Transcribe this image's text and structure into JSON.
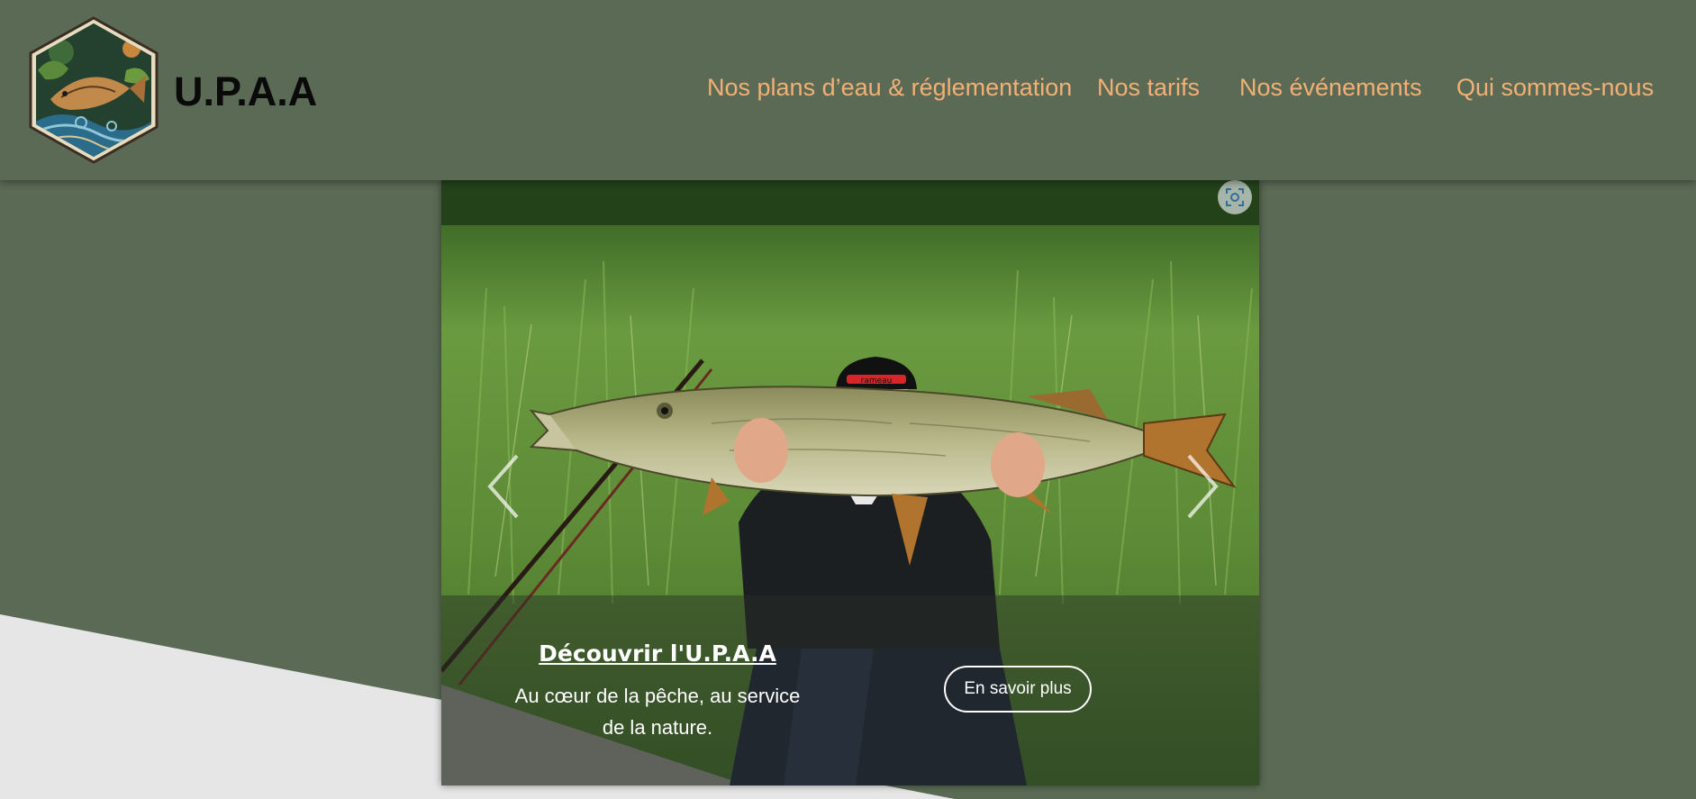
{
  "header": {
    "brand": "U.P.A.A",
    "nav": [
      {
        "label": "Nos plans d’eau & réglementation"
      },
      {
        "label": "Nos tarifs"
      },
      {
        "label": "Nos événements"
      },
      {
        "label": "Qui sommes-nous"
      }
    ]
  },
  "carousel": {
    "caption_title": "Découvrir l'U.P.A.A",
    "caption_text": "Au cœur de la pêche, au service de la nature.",
    "cta_label": "En savoir plus",
    "cap_brand": "rameau"
  },
  "icons": {
    "logo": "fish-emblem-logo",
    "prev": "chevron-left-icon",
    "next": "chevron-right-icon",
    "zoom": "zoom-icon"
  },
  "colors": {
    "background": "#5a6a54",
    "nav_link": "#f3b074",
    "brand": "#0a0a0a",
    "diagonal_light": "#e6e6e6"
  }
}
